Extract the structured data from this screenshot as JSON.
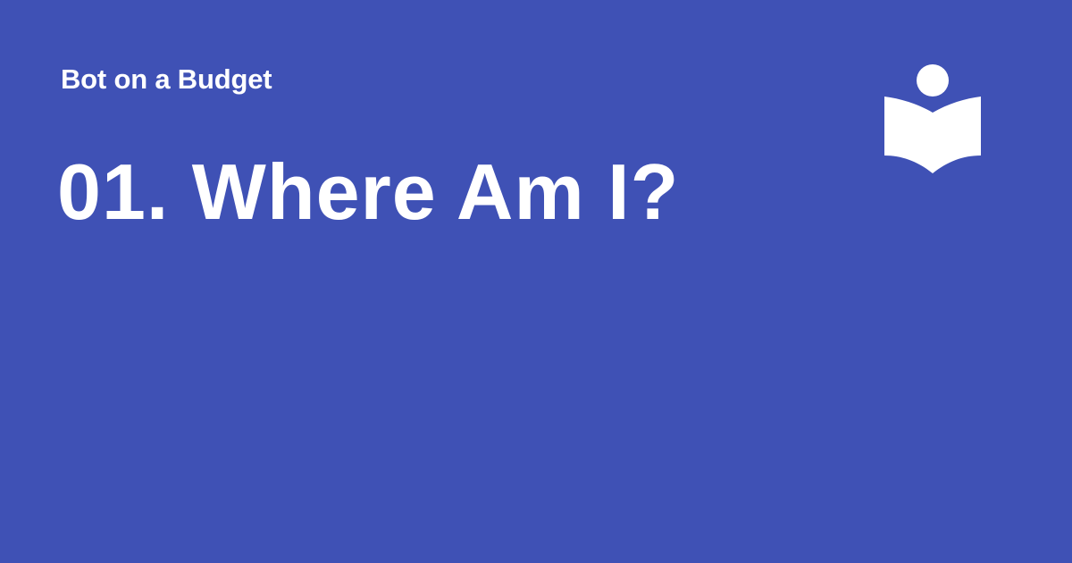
{
  "header": {
    "series_label": "Bot on a Budget"
  },
  "main": {
    "title": "01. Where Am I?"
  },
  "logo": {
    "icon": "reader-book-icon"
  },
  "colors": {
    "background": "#3f51b5",
    "text": "#ffffff"
  }
}
